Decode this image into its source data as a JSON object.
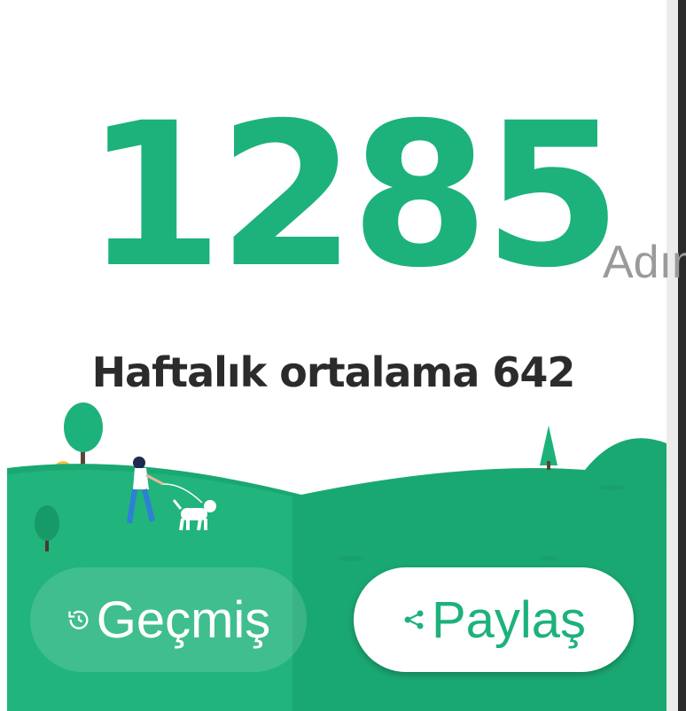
{
  "steps": {
    "count": "1285",
    "unit": "Adım"
  },
  "summary": {
    "weekly_average": "Haftalık ortalama 642"
  },
  "actions": {
    "history_label": "Geçmiş",
    "history_icon": "history-icon",
    "share_label": "Paylaş",
    "share_icon": "share-icon"
  },
  "colors": {
    "accent": "#1db27b",
    "text": "#2b2b2b",
    "muted": "#9a9a9a"
  }
}
